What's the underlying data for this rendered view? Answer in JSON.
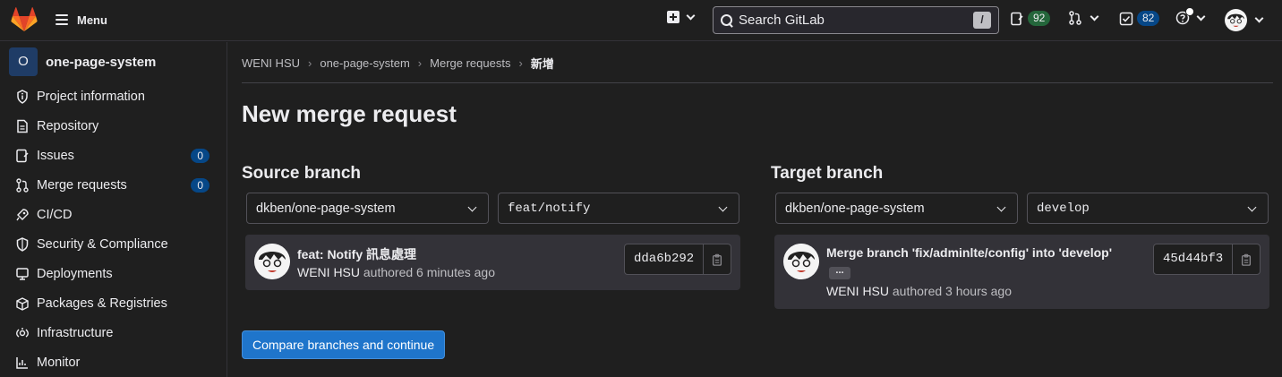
{
  "topbar": {
    "menu_label": "Menu",
    "search_placeholder": "Search GitLab",
    "search_shortcut": "/",
    "issues_count": "92",
    "todos_count": "82"
  },
  "sidebar": {
    "project_initial": "O",
    "project_name": "one-page-system",
    "items": [
      {
        "label": "Project information",
        "icon": "info-icon"
      },
      {
        "label": "Repository",
        "icon": "doc-icon"
      },
      {
        "label": "Issues",
        "icon": "issues-icon",
        "count": "0"
      },
      {
        "label": "Merge requests",
        "icon": "merge-request-icon",
        "count": "0"
      },
      {
        "label": "CI/CD",
        "icon": "rocket-icon"
      },
      {
        "label": "Security & Compliance",
        "icon": "shield-icon"
      },
      {
        "label": "Deployments",
        "icon": "deployments-icon"
      },
      {
        "label": "Packages & Registries",
        "icon": "package-icon"
      },
      {
        "label": "Infrastructure",
        "icon": "infrastructure-icon"
      },
      {
        "label": "Monitor",
        "icon": "monitor-icon"
      }
    ]
  },
  "breadcrumb": [
    "WENI HSU",
    "one-page-system",
    "Merge requests",
    "新增"
  ],
  "page": {
    "title": "New merge request",
    "submit_label": "Compare branches and continue"
  },
  "source": {
    "heading": "Source branch",
    "project": "dkben/one-page-system",
    "branch": "feat/notify",
    "commit_title": "feat: Notify 訊息處理",
    "commit_author": "WENI HSU",
    "commit_time": "authored 6 minutes ago",
    "commit_sha": "dda6b292"
  },
  "target": {
    "heading": "Target branch",
    "project": "dkben/one-page-system",
    "branch": "develop",
    "commit_title": "Merge branch 'fix/adminlte/config' into 'develop'",
    "commit_author": "WENI HSU",
    "commit_time": "authored 3 hours ago",
    "commit_sha": "45d44bf3",
    "ellipsis": "..."
  },
  "colors": {
    "background": "#1f1f1f",
    "card": "#333238",
    "primary": "#1f75cb",
    "badge_blue": "#064787",
    "badge_green": "#24663b"
  }
}
